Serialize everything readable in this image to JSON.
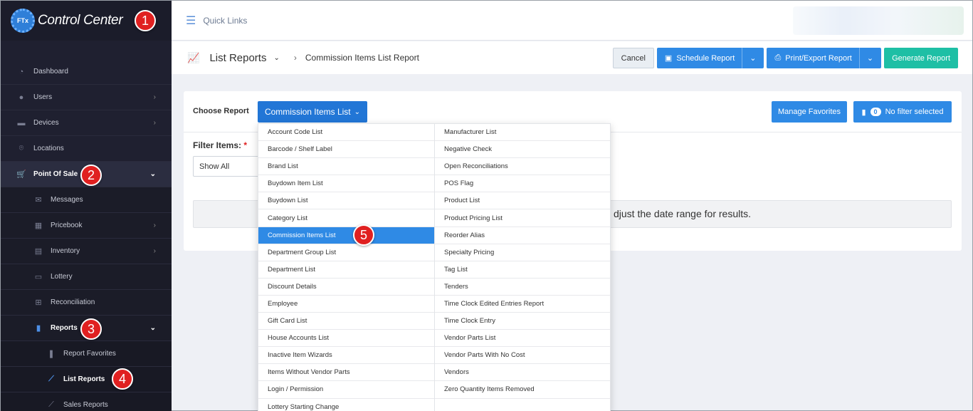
{
  "app": {
    "brand_badge": "FTx",
    "brand_name": "Control Center"
  },
  "callouts": [
    "1",
    "2",
    "3",
    "4",
    "5"
  ],
  "topbar": {
    "quick_links": "Quick Links"
  },
  "sidebar": {
    "items": [
      {
        "label": "Dashboard",
        "icon": "dashboard-icon"
      },
      {
        "label": "Users",
        "icon": "users-icon"
      },
      {
        "label": "Devices",
        "icon": "devices-icon"
      },
      {
        "label": "Locations",
        "icon": "location-pin-icon"
      },
      {
        "label": "Point Of Sale",
        "icon": "cart-icon"
      },
      {
        "label": "Messages",
        "icon": "messages-icon"
      },
      {
        "label": "Pricebook",
        "icon": "calculator-icon"
      },
      {
        "label": "Inventory",
        "icon": "inventory-icon"
      },
      {
        "label": "Lottery",
        "icon": "lottery-icon"
      },
      {
        "label": "Reconciliation",
        "icon": "reconciliation-icon"
      },
      {
        "label": "Reports",
        "icon": "bar-chart-icon"
      },
      {
        "label": "Report Favorites",
        "icon": "bookmark-icon"
      },
      {
        "label": "List Reports",
        "icon": "line-chart-icon"
      },
      {
        "label": "Sales Reports",
        "icon": "area-chart-icon"
      }
    ]
  },
  "header": {
    "title": "List Reports",
    "breadcrumb": "Commission Items List Report",
    "cancel": "Cancel",
    "schedule": "Schedule Report",
    "print_export": "Print/Export Report",
    "generate": "Generate Report"
  },
  "card": {
    "choose_label": "Choose Report",
    "selected_report": "Commission Items List",
    "manage_favorites": "Manage Favorites",
    "filter_count": "0",
    "filter_status": "No filter selected",
    "filter_items_label": "Filter Items:",
    "required_mark": "*",
    "filter_value": "Show All",
    "message_fragment": "djust the date range for results."
  },
  "dropdown": {
    "left": [
      "Account Code List",
      "Barcode / Shelf Label",
      "Brand List",
      "Buydown Item List",
      "Buydown List",
      "Category List",
      "Commission Items List",
      "Department Group List",
      "Department List",
      "Discount Details",
      "Employee",
      "Gift Card List",
      "House Accounts List",
      "Inactive Item Wizards",
      "Items Without Vendor Parts",
      "Login / Permission",
      "Lottery Starting Change"
    ],
    "right": [
      "Manufacturer List",
      "Negative Check",
      "Open Reconciliations",
      "POS Flag",
      "Product List",
      "Product Pricing List",
      "Reorder Alias",
      "Specialty Pricing",
      "Tag List",
      "Tenders",
      "Time Clock Edited Entries Report",
      "Time Clock Entry",
      "Vendor Parts List",
      "Vendor Parts With No Cost",
      "Vendors",
      "Zero Quantity Items Removed"
    ],
    "selected_index": 6
  },
  "colors": {
    "sidebar_bg": "#1f2030",
    "primary": "#2f8ae5",
    "teal": "#1ebfa5",
    "callout": "#e02020"
  }
}
